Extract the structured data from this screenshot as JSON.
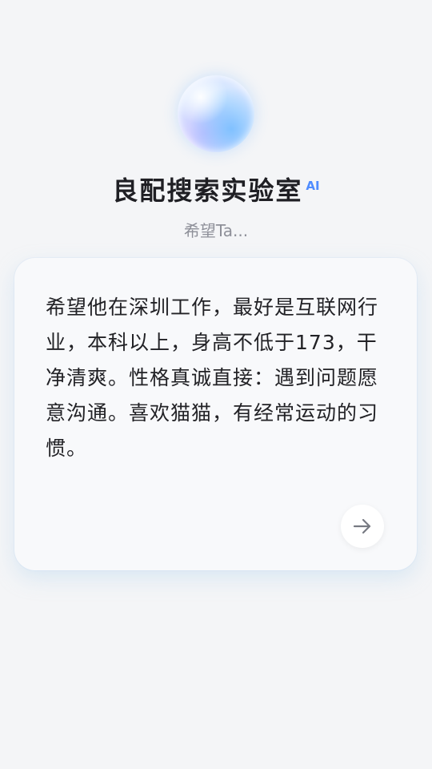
{
  "header": {
    "title": "良配搜索实验室",
    "badge": "AI",
    "subtitle": "希望Ta..."
  },
  "card": {
    "text": "希望他在深圳工作，最好是互联网行业，本科以上，身高不低于173，干净清爽。性格真诚直接：遇到问题愿意沟通。喜欢猫猫，有经常运动的习惯。",
    "send_icon": "arrow-right-icon"
  }
}
